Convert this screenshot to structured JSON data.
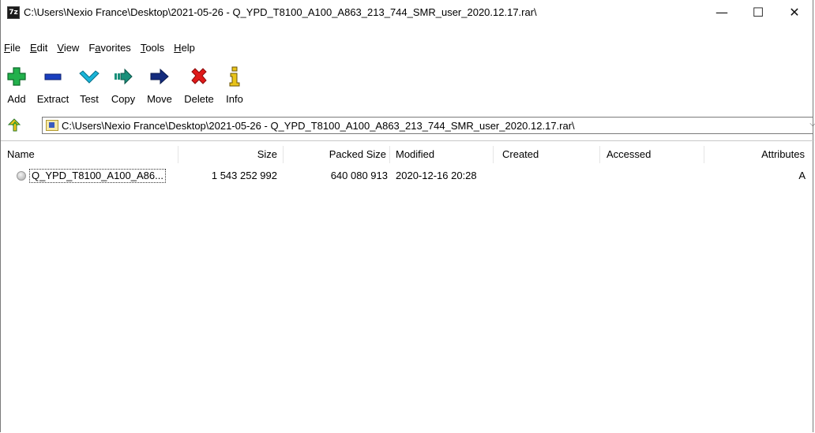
{
  "window": {
    "app_icon_text": "7z",
    "title": "C:\\Users\\Nexio France\\Desktop\\2021-05-26 - Q_YPD_T8100_A100_A863_213_744_SMR_user_2020.12.17.rar\\",
    "minimize_glyph": "—",
    "maximize_glyph": "☐",
    "close_glyph": "✕"
  },
  "menu": {
    "items": [
      {
        "label": "File",
        "accel": "F"
      },
      {
        "label": "Edit",
        "accel": "E"
      },
      {
        "label": "View",
        "accel": "V"
      },
      {
        "label": "Favorites",
        "accel": "a"
      },
      {
        "label": "Tools",
        "accel": "T"
      },
      {
        "label": "Help",
        "accel": "H"
      }
    ]
  },
  "toolbar": {
    "add": "Add",
    "extract": "Extract",
    "test": "Test",
    "copy": "Copy",
    "move": "Move",
    "delete": "Delete",
    "info": "Info"
  },
  "address": {
    "path": "C:\\Users\\Nexio France\\Desktop\\2021-05-26 - Q_YPD_T8100_A100_A863_213_744_SMR_user_2020.12.17.rar\\"
  },
  "list": {
    "columns": {
      "name": "Name",
      "size": "Size",
      "packed_size": "Packed Size",
      "modified": "Modified",
      "created": "Created",
      "accessed": "Accessed",
      "attributes": "Attributes"
    },
    "rows": [
      {
        "name": "Q_YPD_T8100_A100_A86...",
        "size": "1 543 252 992",
        "packed_size": "640 080 913",
        "modified": "2020-12-16 20:28",
        "created": "",
        "accessed": "",
        "attributes": "A"
      }
    ]
  },
  "colors": {
    "add_green": "#22b14c",
    "extract_blue": "#1a3fbf",
    "test_cyan": "#19b4d8",
    "copy_teal": "#1a8f7a",
    "move_navy": "#142c7e",
    "delete_red": "#e01919",
    "info_yellow": "#e9c41a"
  }
}
